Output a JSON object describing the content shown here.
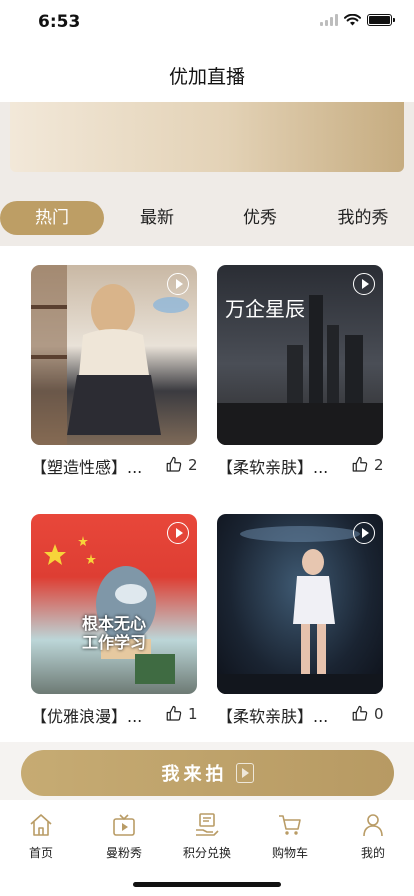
{
  "status": {
    "time": "6:53"
  },
  "nav": {
    "title": "优加直播"
  },
  "tabs": [
    "热门",
    "最新",
    "优秀",
    "我的秀"
  ],
  "active_tab": "热门",
  "videos": [
    {
      "title": "【塑造性感】...",
      "likes": "2",
      "overlay_lines": []
    },
    {
      "title": "【柔软亲肤】...",
      "likes": "2",
      "overlay_lines": [
        "万企星辰"
      ]
    },
    {
      "title": "【优雅浪漫】...",
      "likes": "1",
      "overlay_lines": [
        "根本无心",
        "工作学习"
      ]
    },
    {
      "title": "【柔软亲肤】...",
      "likes": "0",
      "overlay_lines": []
    }
  ],
  "shoot_button": {
    "label": "我来拍"
  },
  "tabbar": [
    {
      "label": "首页",
      "icon": "home-icon"
    },
    {
      "label": "曼粉秀",
      "icon": "tv-play-icon"
    },
    {
      "label": "积分兑换",
      "icon": "points-exchange-icon"
    },
    {
      "label": "购物车",
      "icon": "cart-icon"
    },
    {
      "label": "我的",
      "icon": "profile-icon"
    }
  ],
  "colors": {
    "accent": "#bd9e65",
    "tab_bg": "#efebe7",
    "icon_gold": "#b99c66"
  }
}
